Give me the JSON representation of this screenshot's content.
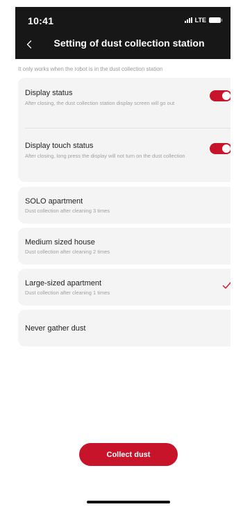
{
  "status_bar": {
    "time": "10:41",
    "network": "LTE"
  },
  "header": {
    "title": "Setting of dust collection station"
  },
  "note": "It only works when the robot is in the dust collection station",
  "toggles": [
    {
      "title": "Display status",
      "description": "After closing, the dust collection station display screen will go out",
      "on": true
    },
    {
      "title": "Display touch status",
      "description": "After closing, long press the display will not turn on the dust collection",
      "on": true
    }
  ],
  "options": [
    {
      "title": "SOLO apartment",
      "description": "Dust collection after cleaning 3 times",
      "selected": false
    },
    {
      "title": "Medium sized house",
      "description": "Dust collection after cleaning 2 times",
      "selected": false
    },
    {
      "title": "Large-sized apartment",
      "description": "Dust collection after cleaning 1 times",
      "selected": true
    },
    {
      "title": "Never gather dust",
      "description": "",
      "selected": false
    }
  ],
  "actions": {
    "collect_label": "Collect dust"
  },
  "colors": {
    "accent": "#c8142a",
    "header_bg": "#171717",
    "card_bg": "#f4f4f4"
  }
}
